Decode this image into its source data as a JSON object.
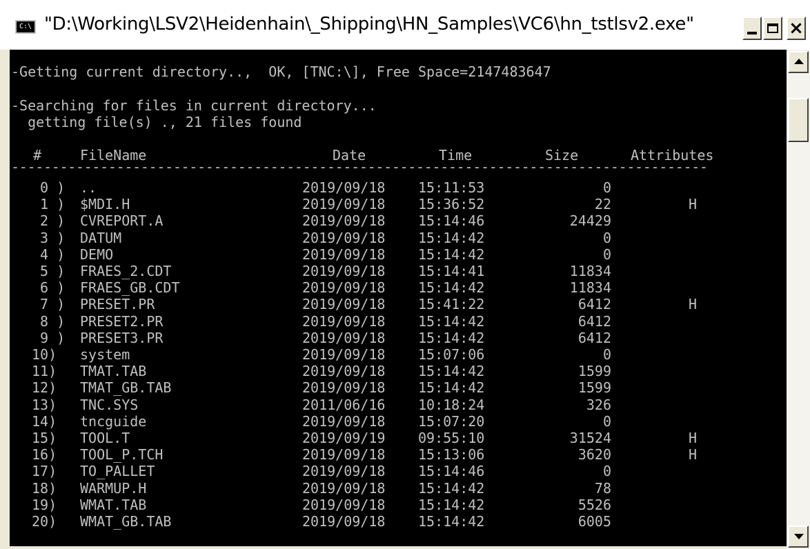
{
  "window": {
    "title": "\"D:\\Working\\LSV2\\Heidenhain\\_Shipping\\HN_Samples\\VC6\\hn_tstlsv2.exe\"",
    "icon_label": "C:\\"
  },
  "console": {
    "line1": "-Getting current directory..,  OK, [TNC:\\], Free Space=2147483647",
    "line2": "-Searching for files in current directory...",
    "line3": "  getting file(s) ., 21 files found",
    "separator": "--------------------------------------------------------------------------------------",
    "headers": {
      "num": "#",
      "filename": "FileName",
      "date": "Date",
      "time": "Time",
      "size": "Size",
      "attributes": "Attributes"
    },
    "files": [
      {
        "num": " 0 )",
        "name": "..",
        "date": "2019/09/18",
        "time": "15:11:53",
        "size": "0",
        "attr": ""
      },
      {
        "num": " 1 )",
        "name": "$MDI.H",
        "date": "2019/09/18",
        "time": "15:36:52",
        "size": "22",
        "attr": "H"
      },
      {
        "num": " 2 )",
        "name": "CVREPORT.A",
        "date": "2019/09/18",
        "time": "15:14:46",
        "size": "24429",
        "attr": ""
      },
      {
        "num": " 3 )",
        "name": "DATUM",
        "date": "2019/09/18",
        "time": "15:14:42",
        "size": "0",
        "attr": ""
      },
      {
        "num": " 4 )",
        "name": "DEMO",
        "date": "2019/09/18",
        "time": "15:14:42",
        "size": "0",
        "attr": ""
      },
      {
        "num": " 5 )",
        "name": "FRAES_2.CDT",
        "date": "2019/09/18",
        "time": "15:14:41",
        "size": "11834",
        "attr": ""
      },
      {
        "num": " 6 )",
        "name": "FRAES_GB.CDT",
        "date": "2019/09/18",
        "time": "15:14:42",
        "size": "11834",
        "attr": ""
      },
      {
        "num": " 7 )",
        "name": "PRESET.PR",
        "date": "2019/09/18",
        "time": "15:41:22",
        "size": "6412",
        "attr": "H"
      },
      {
        "num": " 8 )",
        "name": "PRESET2.PR",
        "date": "2019/09/18",
        "time": "15:14:42",
        "size": "6412",
        "attr": ""
      },
      {
        "num": " 9 )",
        "name": "PRESET3.PR",
        "date": "2019/09/18",
        "time": "15:14:42",
        "size": "6412",
        "attr": ""
      },
      {
        "num": "10)",
        "name": "system",
        "date": "2019/09/18",
        "time": "15:07:06",
        "size": "0",
        "attr": ""
      },
      {
        "num": "11)",
        "name": "TMAT.TAB",
        "date": "2019/09/18",
        "time": "15:14:42",
        "size": "1599",
        "attr": ""
      },
      {
        "num": "12)",
        "name": "TMAT_GB.TAB",
        "date": "2019/09/18",
        "time": "15:14:42",
        "size": "1599",
        "attr": ""
      },
      {
        "num": "13)",
        "name": "TNC.SYS",
        "date": "2011/06/16",
        "time": "10:18:24",
        "size": "326",
        "attr": ""
      },
      {
        "num": "14)",
        "name": "tncguide",
        "date": "2019/09/18",
        "time": "15:07:20",
        "size": "0",
        "attr": ""
      },
      {
        "num": "15)",
        "name": "TOOL.T",
        "date": "2019/09/19",
        "time": "09:55:10",
        "size": "31524",
        "attr": "H"
      },
      {
        "num": "16)",
        "name": "TOOL_P.TCH",
        "date": "2019/09/18",
        "time": "15:13:06",
        "size": "3620",
        "attr": "H"
      },
      {
        "num": "17)",
        "name": "TO_PALLET",
        "date": "2019/09/18",
        "time": "15:14:46",
        "size": "0",
        "attr": ""
      },
      {
        "num": "18)",
        "name": "WARMUP.H",
        "date": "2019/09/18",
        "time": "15:14:42",
        "size": "78",
        "attr": ""
      },
      {
        "num": "19)",
        "name": "WMAT.TAB",
        "date": "2019/09/18",
        "time": "15:14:42",
        "size": "5526",
        "attr": ""
      },
      {
        "num": "20)",
        "name": "WMAT_GB.TAB",
        "date": "2019/09/18",
        "time": "15:14:42",
        "size": "6005",
        "attr": ""
      }
    ]
  },
  "colors": {
    "console_bg": "#000000",
    "console_text": "#c0c0c0",
    "titlebar_bg": "#ffffff",
    "chrome": "#ece9d8"
  }
}
